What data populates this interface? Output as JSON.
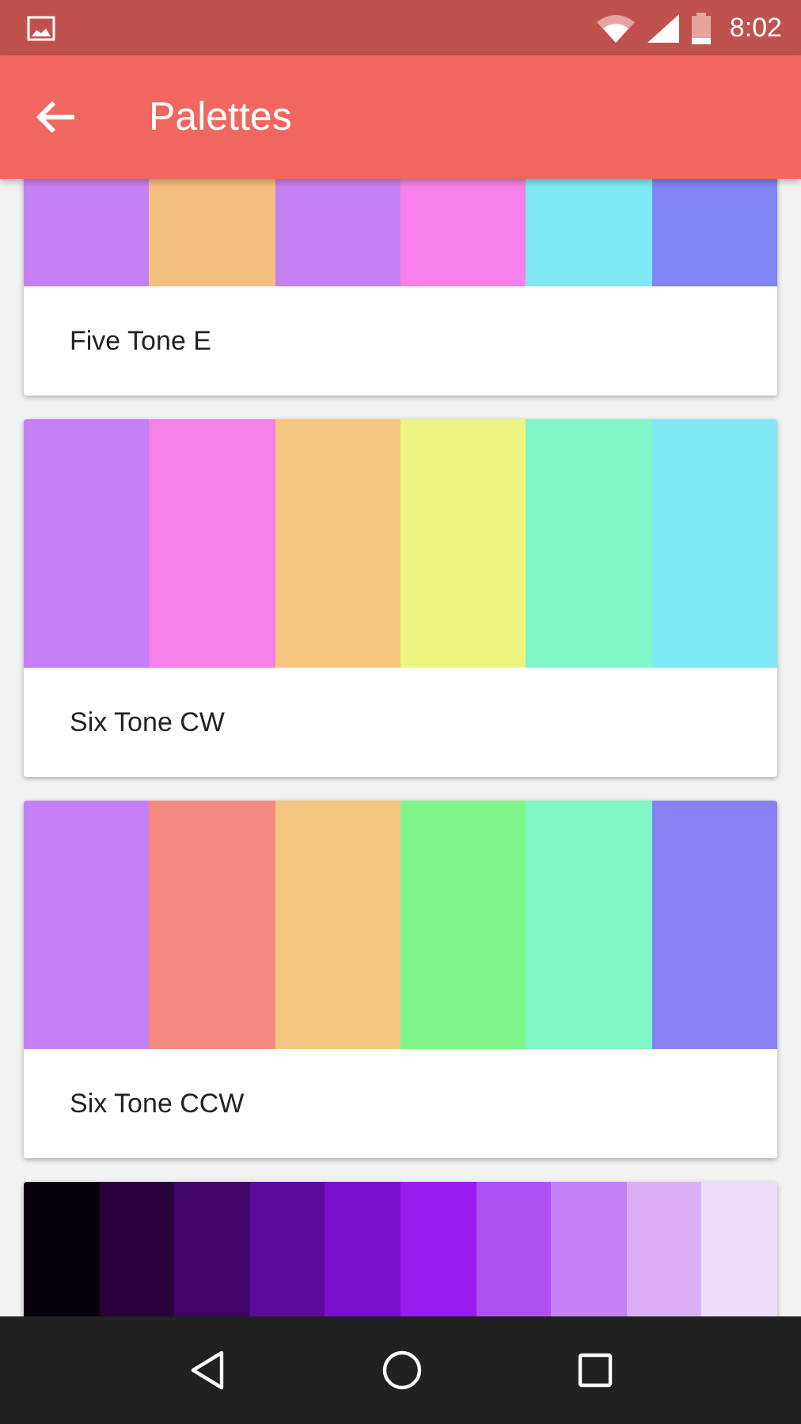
{
  "status_bar": {
    "time": "8:02"
  },
  "app_bar": {
    "title": "Palettes"
  },
  "palettes": [
    {
      "name": "Five Tone E",
      "swatches": [
        {
          "color": "#c680f5"
        },
        {
          "color": "#f5bf80"
        },
        {
          "color": "#c680f5"
        },
        {
          "color": "#f580e8"
        },
        {
          "color": "#80e8f5"
        },
        {
          "color": "#8084f5"
        }
      ]
    },
    {
      "name": "Six Tone CW",
      "swatches": [
        {
          "color": "#c680f5"
        },
        {
          "color": "#f580e8"
        },
        {
          "color": "#f5c680"
        },
        {
          "color": "#ebf580"
        },
        {
          "color": "#80f5c6"
        },
        {
          "color": "#80e8f5"
        }
      ]
    },
    {
      "name": "Six Tone CCW",
      "swatches": [
        {
          "color": "#c680f5"
        },
        {
          "color": "#f58a80"
        },
        {
          "color": "#f5c680"
        },
        {
          "color": "#80f58a"
        },
        {
          "color": "#80f5c6"
        },
        {
          "color": "#8a80f5"
        }
      ]
    },
    {
      "swatches": [
        {
          "color": "#07000b"
        },
        {
          "color": "#28003a"
        },
        {
          "color": "#420468"
        },
        {
          "color": "#5b0a99"
        },
        {
          "color": "#7b0ecb"
        },
        {
          "color": "#9a1bef"
        },
        {
          "color": "#b050f3"
        },
        {
          "color": "#c680f5"
        },
        {
          "color": "#dbaff7"
        },
        {
          "color": "#eedcfd"
        }
      ]
    }
  ]
}
